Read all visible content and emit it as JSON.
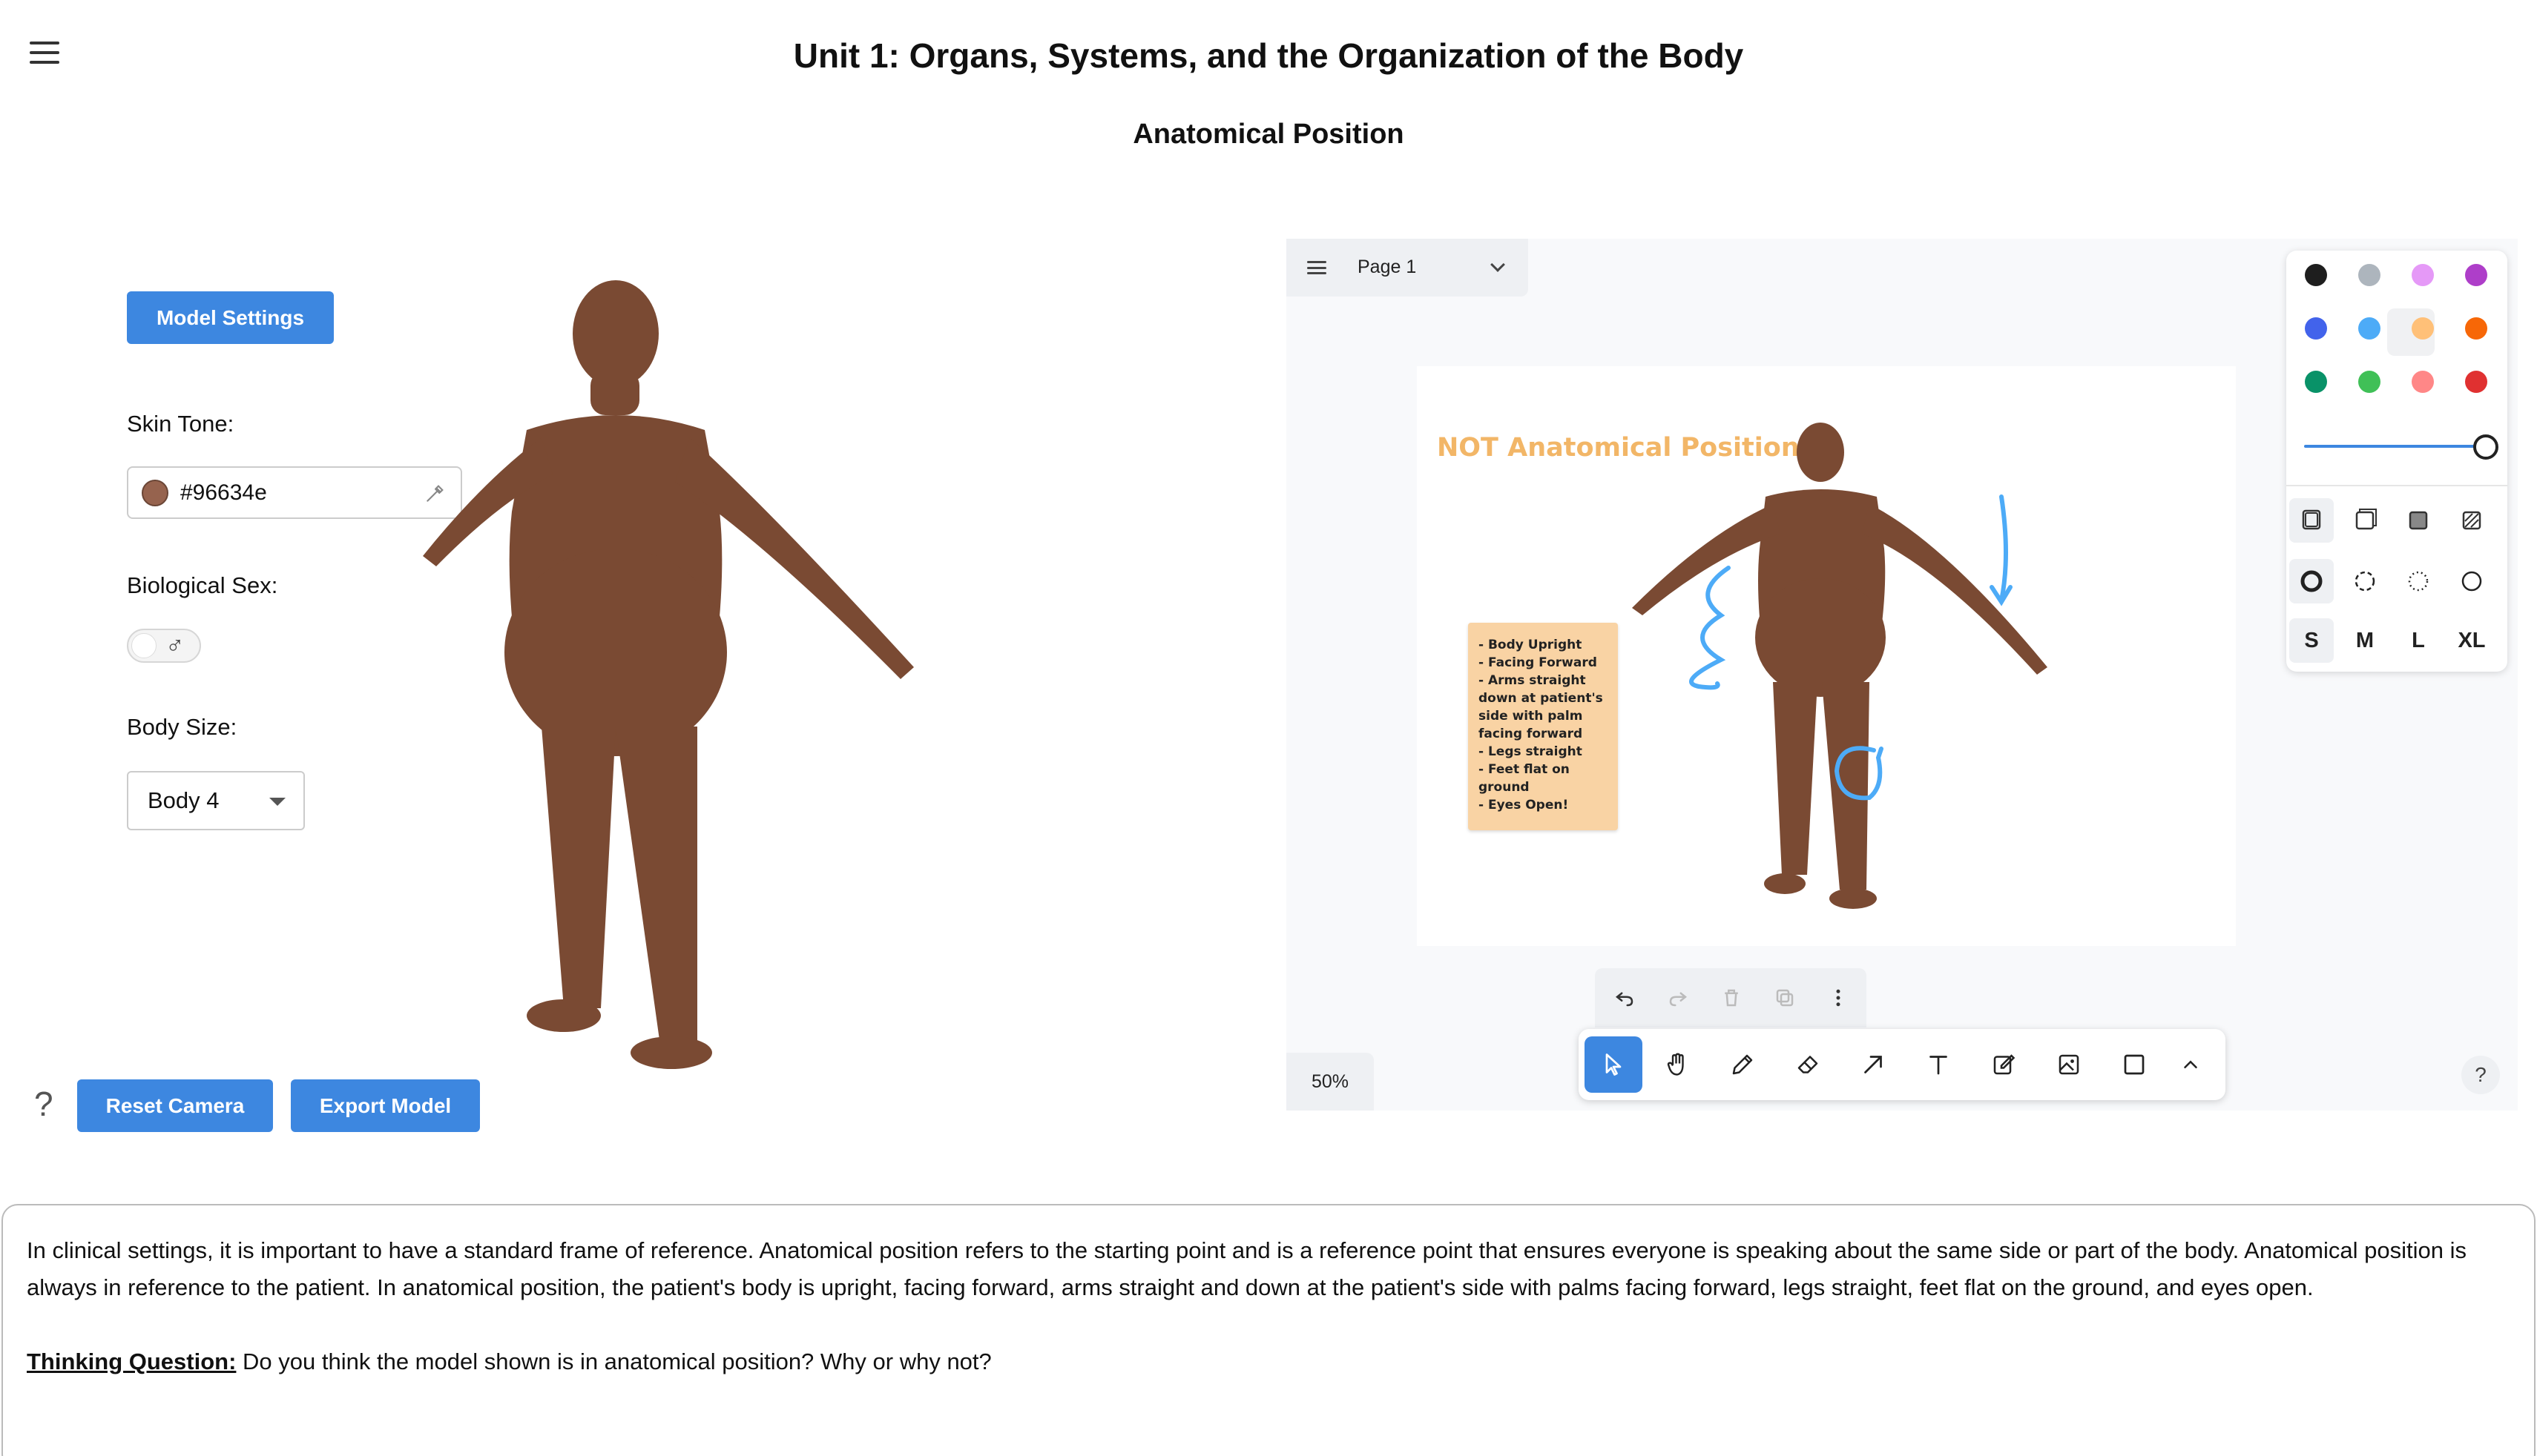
{
  "header": {
    "title": "Unit 1: Organs, Systems, and the Organization of the Body",
    "subtitle": "Anatomical Position"
  },
  "controls": {
    "model_settings_label": "Model Settings",
    "skin_tone_label": "Skin Tone:",
    "skin_tone_value": "#96634e",
    "biological_sex_label": "Biological Sex:",
    "biological_sex_symbol": "♂",
    "body_size_label": "Body Size:",
    "body_size_value": "Body 4",
    "help_symbol": "?",
    "reset_camera_label": "Reset Camera",
    "export_model_label": "Export Model"
  },
  "whiteboard": {
    "page_label": "Page 1",
    "annotation_title": "NOT Anatomical Position!",
    "sticky_lines": [
      "- Body Upright",
      "- Facing Forward",
      "- Arms straight",
      "down at patient's",
      "side with palm",
      "facing forward",
      "- Legs straight",
      "- Feet flat on",
      "ground",
      "- Eyes Open!"
    ],
    "zoom_label": "50%",
    "help_symbol": "?",
    "sizes": [
      "S",
      "M",
      "L",
      "XL"
    ],
    "palette": [
      "#1e1e1e",
      "#adb5bd",
      "#e599f7",
      "#ae3ec9",
      "#4263eb",
      "#4dabf7",
      "#ffc078",
      "#f76707",
      "#099268",
      "#40c057",
      "#ff8787",
      "#e03131"
    ],
    "skin_color": "#96634e",
    "accent_color": "#3d87e0"
  },
  "content": {
    "paragraph": "In clinical settings, it is important to have a standard frame of reference. Anatomical position refers to the starting point and is a reference point that ensures everyone is speaking about the same side or part of the body. Anatomical position is always in reference to the patient. In anatomical position, the patient's body is upright, facing forward, arms straight and down at the patient's side with palms facing forward, legs straight, feet flat on the ground, and eyes open.",
    "thinking_label": "Thinking Question:",
    "thinking_text": " Do you think the model shown is in anatomical position? Why or why not?"
  }
}
